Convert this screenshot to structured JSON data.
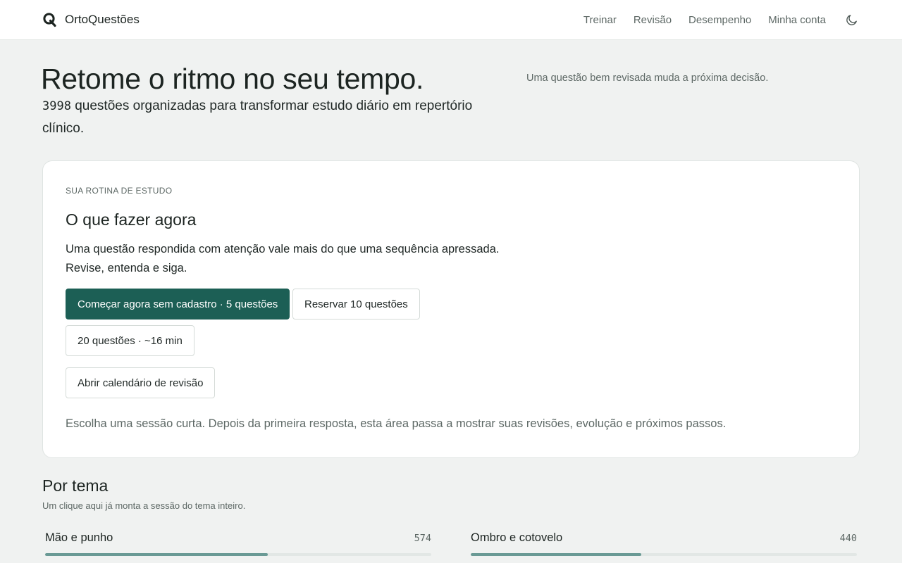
{
  "header": {
    "brand_name": "OrtoQuestões",
    "nav": [
      "Treinar",
      "Revisão",
      "Desempenho",
      "Minha conta"
    ],
    "theme_icon": "moon-icon"
  },
  "hero": {
    "title": "Retome o ritmo no seu tempo.",
    "count": "3998",
    "subtitle_rest": " questões organizadas para transformar estudo diário em repertório clínico.",
    "side_note": "Uma questão bem revisada muda a próxima decisão."
  },
  "routine": {
    "eyebrow": "SUA ROTINA DE ESTUDO",
    "title": "O que fazer agora",
    "text_line1": "Uma questão respondida com atenção vale mais do que uma sequência apressada.",
    "text_line2": "Revise, entenda e siga.",
    "btn_start": "Começar agora sem cadastro · 5 questões",
    "btn_reserve": "Reservar 10 questões",
    "btn_twenty": "20 questões · ~16 min",
    "btn_calendar": "Abrir calendário de revisão",
    "note": "Escolha uma sessão curta. Depois da primeira resposta, esta área passa a mostrar suas revisões, evolução e próximos passos."
  },
  "topics": {
    "title": "Por tema",
    "subtitle": "Um clique aqui já monta a sessão do tema inteiro.",
    "items": [
      {
        "name": "Mão e punho",
        "count": "574",
        "progress": 0.577
      },
      {
        "name": "Ombro e cotovelo",
        "count": "440",
        "progress": 0.442
      }
    ]
  },
  "colors": {
    "accent": "#1c5f55",
    "progress_fill": "#6a9a95",
    "background": "#f0f2f1"
  }
}
